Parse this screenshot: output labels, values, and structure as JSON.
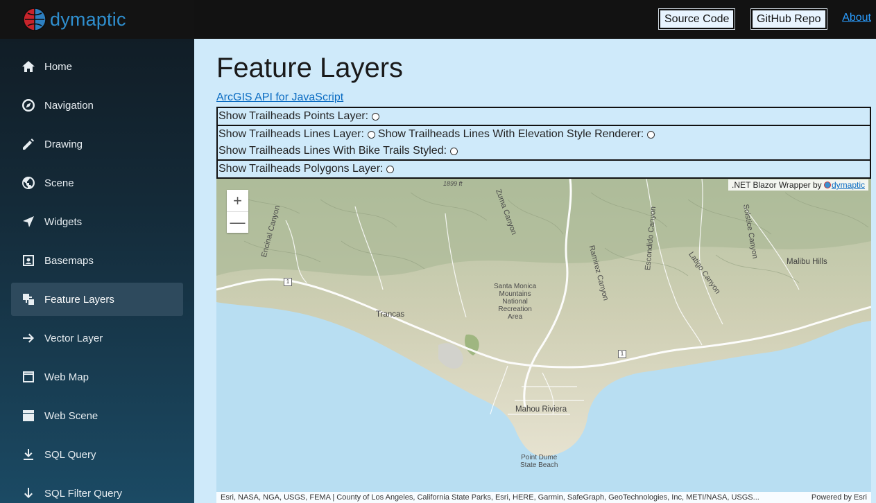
{
  "brand": {
    "name": "dymaptic"
  },
  "sidebar": {
    "items": [
      {
        "label": "Home",
        "icon": "home-icon"
      },
      {
        "label": "Navigation",
        "icon": "compass-icon"
      },
      {
        "label": "Drawing",
        "icon": "pencil-icon"
      },
      {
        "label": "Scene",
        "icon": "globe-icon"
      },
      {
        "label": "Widgets",
        "icon": "location-arrow-icon"
      },
      {
        "label": "Basemaps",
        "icon": "image-frame-icon"
      },
      {
        "label": "Feature Layers",
        "icon": "layers-icon",
        "active": true
      },
      {
        "label": "Vector Layer",
        "icon": "arrow-right-icon"
      },
      {
        "label": "Web Map",
        "icon": "browser-window-icon"
      },
      {
        "label": "Web Scene",
        "icon": "window-box-icon"
      },
      {
        "label": "SQL Query",
        "icon": "download-icon"
      },
      {
        "label": "SQL Filter Query",
        "icon": "arrow-down-icon"
      }
    ]
  },
  "topbar": {
    "source_code": "Source Code",
    "github_repo": "GitHub Repo",
    "about": "About"
  },
  "main": {
    "title": "Feature Layers",
    "api_link": "ArcGIS API for JavaScript",
    "options": {
      "points": "Show Trailheads Points Layer:",
      "lines": "Show Trailheads Lines Layer:",
      "lines_elevation": "Show Trailheads Lines With Elevation Style Renderer:",
      "lines_bike": "Show Trailheads Lines With Bike Trails Styled:",
      "polygons": "Show Trailheads Polygons Layer:"
    }
  },
  "map": {
    "zoom_in": "+",
    "zoom_out": "—",
    "wrapper_note": ".NET Blazor Wrapper by",
    "wrapper_link": "dymaptic",
    "labels": {
      "trancas": "Trancas",
      "smm_line1": "Santa Monica",
      "smm_line2": "Mountains",
      "smm_line3": "National",
      "smm_line4": "Recreation",
      "smm_line5": "Area",
      "mahou": "Mahou Riviera",
      "point_dume_1": "Point Dume",
      "point_dume_2": "State Beach",
      "malibu_hills": "Malibu Hills",
      "zuma": "Zuma Canyon",
      "ramirez": "Ramirez Canyon",
      "escondido": "Escondido Canyon",
      "latigo": "Latigo Canyon",
      "solstice": "Solstice Canyon",
      "encinal": "Encinal Canyon",
      "elevation": "1899 ft",
      "route": "1"
    },
    "attribution": "Esri, NASA, NGA, USGS, FEMA | County of Los Angeles, California State Parks, Esri, HERE, Garmin, SafeGraph, GeoTechnologies, Inc, METI/NASA, USGS...",
    "powered_by": "Powered by Esri"
  },
  "colors": {
    "sidebar_top": "#101a22",
    "sidebar_bottom": "#1b4a64",
    "active_item": "#2e4a5d",
    "page_bg": "#cfeafa",
    "brand": "#2f8fcf",
    "link": "#0b6cc2"
  }
}
